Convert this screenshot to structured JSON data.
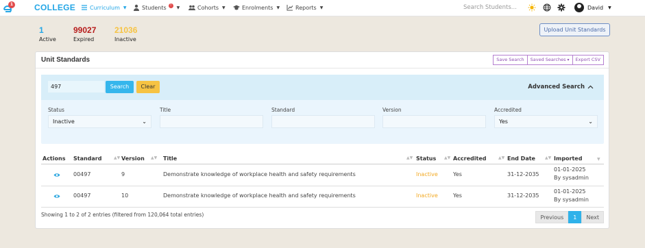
{
  "navbar": {
    "logo_badge": "1",
    "brand": "COLLEGE",
    "items": [
      {
        "label": "Curriculum",
        "icon": "list-icon"
      },
      {
        "label": "Students",
        "icon": "user-icon",
        "badge": "!"
      },
      {
        "label": "Cohorts",
        "icon": "users-icon"
      },
      {
        "label": "Enrolments",
        "icon": "graduation-cap-icon"
      },
      {
        "label": "Reports",
        "icon": "chart-line-icon"
      }
    ],
    "search_placeholder": "Search Students...",
    "user_name": "David"
  },
  "stats": [
    {
      "value": "1",
      "label": "Active",
      "color": "#23a6e6"
    },
    {
      "value": "99027",
      "label": "Expired",
      "color": "#b71c1c"
    },
    {
      "value": "21036",
      "label": "Inactive",
      "color": "#f6c343"
    }
  ],
  "upload_button": "Upload Unit Standards",
  "card": {
    "title": "Unit Standards",
    "buttons": [
      "Save Search",
      "Saved Searches",
      "Export CSV"
    ]
  },
  "filters": {
    "standard_value": "497",
    "search_button": "Search",
    "clear_button": "Clear",
    "advanced_label": "Advanced Search",
    "fields": [
      {
        "label": "Status",
        "value": "Inactive",
        "type": "select"
      },
      {
        "label": "Title",
        "value": "",
        "type": "text"
      },
      {
        "label": "Standard",
        "value": "",
        "type": "text"
      },
      {
        "label": "Version",
        "value": "",
        "type": "text"
      },
      {
        "label": "Accredited",
        "value": "Yes",
        "type": "select"
      }
    ]
  },
  "table": {
    "headers": [
      "Actions",
      "Standard",
      "Version",
      "Title",
      "Status",
      "Accredited",
      "End Date",
      "Imported"
    ],
    "rows": [
      {
        "standard": "00497",
        "version": "9",
        "title": "Demonstrate knowledge of workplace health and safety requirements",
        "status": "Inactive",
        "accredited": "Yes",
        "end_date": "31-12-2035",
        "imported_date": "01-01-2025",
        "imported_by": "By sysadmin"
      },
      {
        "standard": "00497",
        "version": "10",
        "title": "Demonstrate knowledge of workplace health and safety requirements",
        "status": "Inactive",
        "accredited": "Yes",
        "end_date": "31-12-2035",
        "imported_date": "01-01-2025",
        "imported_by": "By sysadmin"
      }
    ],
    "info": "Showing 1 to 2 of 2 entries (filtered from 120,064 total entries)"
  },
  "pagination": {
    "previous": "Previous",
    "current": "1",
    "next": "Next"
  },
  "colors": {
    "accent": "#23a6e6",
    "inactive_status": "#f2a922",
    "filter_bg": "#d8eef9"
  }
}
